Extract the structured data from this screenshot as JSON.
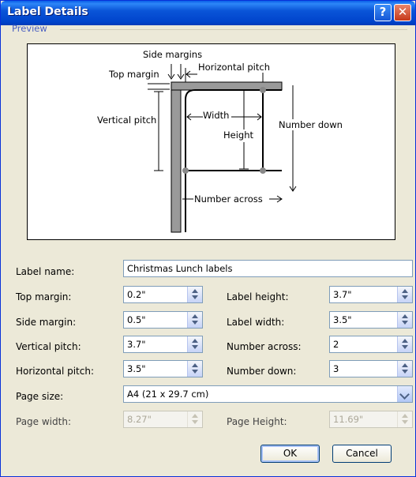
{
  "window": {
    "title": "Label Details",
    "help_glyph": "?",
    "close_glyph": "✕"
  },
  "preview": {
    "group_label": "Preview",
    "labels": {
      "side_margins": "Side margins",
      "top_margin": "Top margin",
      "horizontal_pitch": "Horizontal pitch",
      "vertical_pitch": "Vertical pitch",
      "width": "Width",
      "height": "Height",
      "number_down": "Number down",
      "number_across": "Number across"
    }
  },
  "form": {
    "label_name": {
      "label": "Label name:",
      "value": "Christmas Lunch labels"
    },
    "top_margin": {
      "label": "Top margin:",
      "value": "0.2\""
    },
    "side_margin": {
      "label": "Side margin:",
      "value": "0.5\""
    },
    "vertical_pitch": {
      "label": "Vertical pitch:",
      "value": "3.7\""
    },
    "horizontal_pitch": {
      "label": "Horizontal pitch:",
      "value": "3.5\""
    },
    "label_height": {
      "label": "Label height:",
      "value": "3.7\""
    },
    "label_width": {
      "label": "Label width:",
      "value": "3.5\""
    },
    "number_across": {
      "label": "Number across:",
      "value": "2"
    },
    "number_down": {
      "label": "Number down:",
      "value": "3"
    },
    "page_size": {
      "label": "Page size:",
      "value": "A4 (21 x 29.7 cm)"
    },
    "page_width": {
      "label": "Page width:",
      "value": "8.27\""
    },
    "page_height": {
      "label": "Page Height:",
      "value": "11.69\""
    }
  },
  "buttons": {
    "ok": "OK",
    "cancel": "Cancel"
  }
}
